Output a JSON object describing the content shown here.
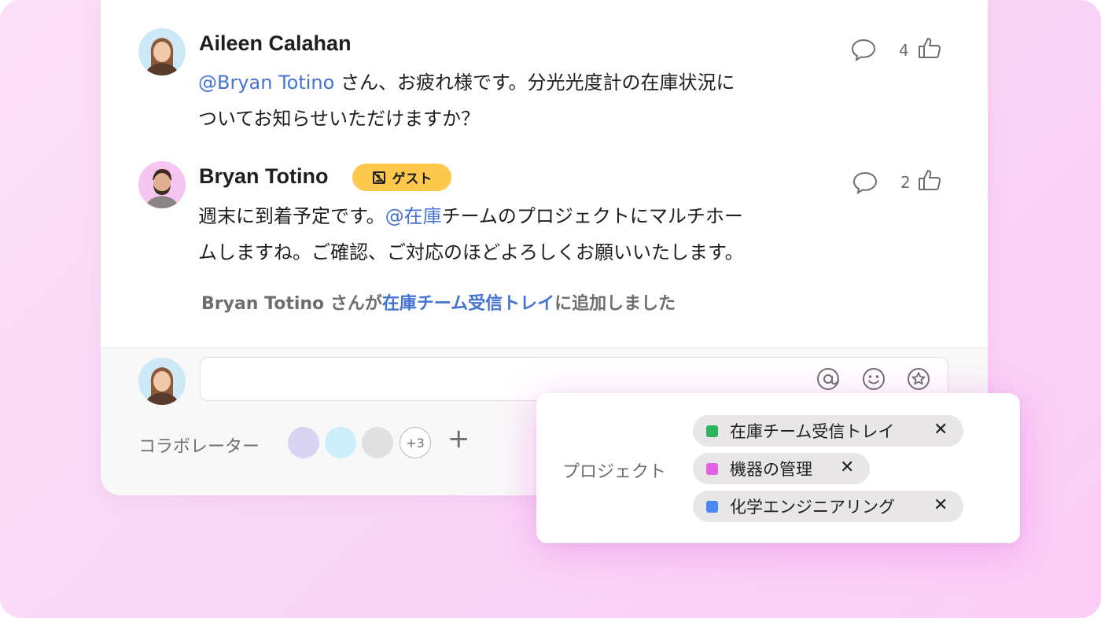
{
  "comments": [
    {
      "author": "Aileen Calahan",
      "mention": "@Bryan Totino",
      "line1_rest": " さん、お疲れ様です。分光光度計の在庫状況に",
      "line2": "ついてお知らせいただけますか？",
      "likes": "4"
    },
    {
      "author": "Bryan Totino",
      "badge": "ゲスト",
      "line1_pre": "週末に到着予定です。",
      "mention": "@在庫",
      "line1_post": "チームのプロジェクトにマルチホー",
      "line2": "ムしますね。ご確認、ご対応のほどよろしくお願いいたします。",
      "likes": "2"
    }
  ],
  "system_message": {
    "prefix": "Bryan Totino さんが",
    "link": "在庫チーム受信トレイ",
    "suffix": "に追加しました"
  },
  "composer": {
    "placeholder": ""
  },
  "collaborators": {
    "label": "コラボレーター",
    "more": "+3",
    "add": "+"
  },
  "projects": {
    "label": "プロジェクト",
    "items": [
      {
        "name": "在庫チーム受信トレイ",
        "color": "#2db45f"
      },
      {
        "name": "機器の管理",
        "color": "#e362e3"
      },
      {
        "name": "化学エンジニアリング",
        "color": "#4a86f4"
      }
    ],
    "remove": "✕"
  },
  "icons": {
    "comment": "speech-bubble-icon",
    "like": "thumbs-up-icon",
    "mention": "at-sign-icon",
    "emoji": "smiley-icon",
    "star": "star-icon",
    "guest": "guest-icon"
  },
  "colors": {
    "mention": "#4573d2",
    "guest_badge": "#fdc84c",
    "background": "#f9d8f6"
  }
}
